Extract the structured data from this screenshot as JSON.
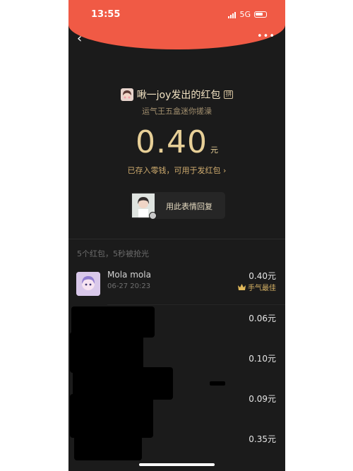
{
  "status_bar": {
    "time": "13:55",
    "network": "5G"
  },
  "nav": {
    "back_glyph": "‹",
    "more_glyph": "•••"
  },
  "envelope": {
    "sender_title": "啾一joy发出的红包",
    "pin_badge": "拼",
    "subtitle": "运气王五盒迷你搓澡",
    "amount": "0.40",
    "amount_unit": "元",
    "deposit_text": "已存入零钱，可用于发红包 ›"
  },
  "reply_button": {
    "label": "用此表情回复"
  },
  "summary": "5个红包，5秒被抢光",
  "receivers": [
    {
      "name": "Mola mola",
      "time": "06-27 20:23",
      "amount": "0.40元",
      "badge": "手气最佳"
    },
    {
      "name": "",
      "time": "",
      "amount": "0.06元"
    },
    {
      "name": "",
      "time": "",
      "amount": "0.10元"
    },
    {
      "name": "",
      "time": "",
      "amount": "0.09元"
    },
    {
      "name": "",
      "time": "",
      "amount": "0.35元"
    }
  ],
  "colors": {
    "header": "#f05a45",
    "gold": "#e7cf97",
    "background": "#1b1b1b"
  }
}
